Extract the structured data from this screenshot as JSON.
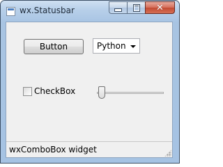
{
  "window": {
    "title": "wx.Statusbar",
    "caption_buttons": {
      "minimize_icon": "minimize-icon",
      "maximize_icon": "maximize-icon",
      "close_icon": "close-icon",
      "close_glyph": "✕"
    }
  },
  "content": {
    "button_label": "Button",
    "combo": {
      "selected": "Python"
    },
    "checkbox": {
      "label": "CheckBox",
      "checked": false
    },
    "slider": {
      "value_fraction": 0.0
    }
  },
  "statusbar": {
    "text": "wxComboBox widget"
  },
  "colors": {
    "titlebar": "#b9d1ea",
    "client_bg": "#f0f0f0",
    "close_button": "#c24a33"
  }
}
